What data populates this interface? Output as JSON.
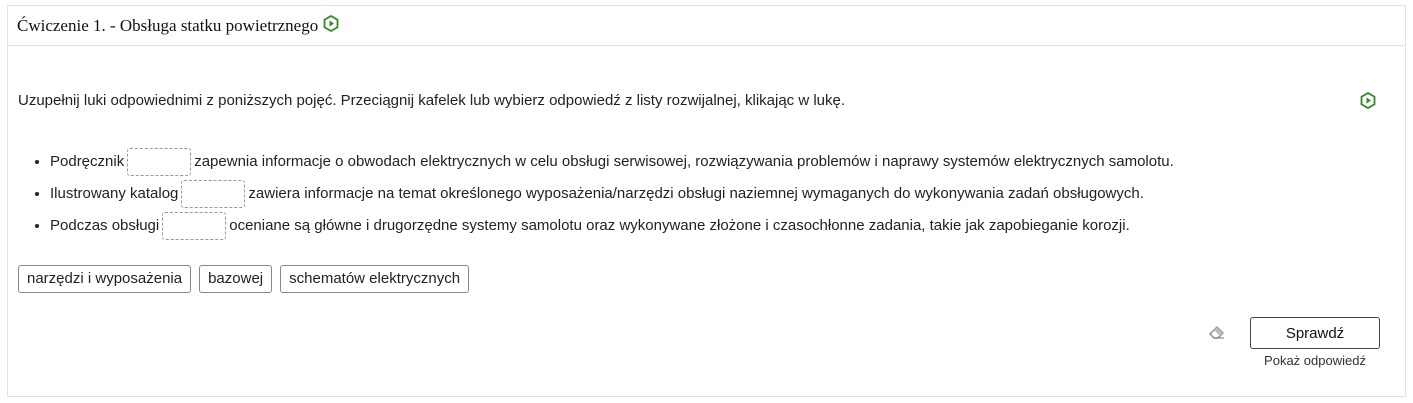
{
  "exercise": {
    "title": "Ćwiczenie 1. - Obsługa statku powietrznego",
    "instruction": "Uzupełnij luki odpowiednimi z poniższych pojęć. Przeciągnij kafelek lub wybierz odpowiedź z listy rozwijalnej, klikając w lukę.",
    "items": [
      {
        "before": "Podręcznik",
        "after": "zapewnia informacje o obwodach elektrycznych w celu obsługi serwisowej, rozwiązywania problemów i naprawy systemów elektrycznych samolotu."
      },
      {
        "before": "Ilustrowany katalog",
        "after": "zawiera informacje na temat określonego wyposażenia/narzędzi obsługi naziemnej wymaganych do wykonywania zadań obsługowych."
      },
      {
        "before": "Podczas obsługi",
        "after": "oceniane są główne i drugorzędne systemy samolotu oraz wykonywane złożone i czasochłonne zadania, takie jak zapobieganie korozji."
      }
    ],
    "tiles": [
      "narzędzi i wyposażenia",
      "bazowej",
      "schematów elektrycznych"
    ],
    "check_label": "Sprawdź",
    "show_answer_label": "Pokaż odpowiedź"
  },
  "icons": {
    "title_icon": "hexagon-play-icon",
    "instruction_icon": "hexagon-play-icon",
    "reset_icon": "eraser-icon"
  },
  "colors": {
    "accent": "#2e8b22"
  }
}
